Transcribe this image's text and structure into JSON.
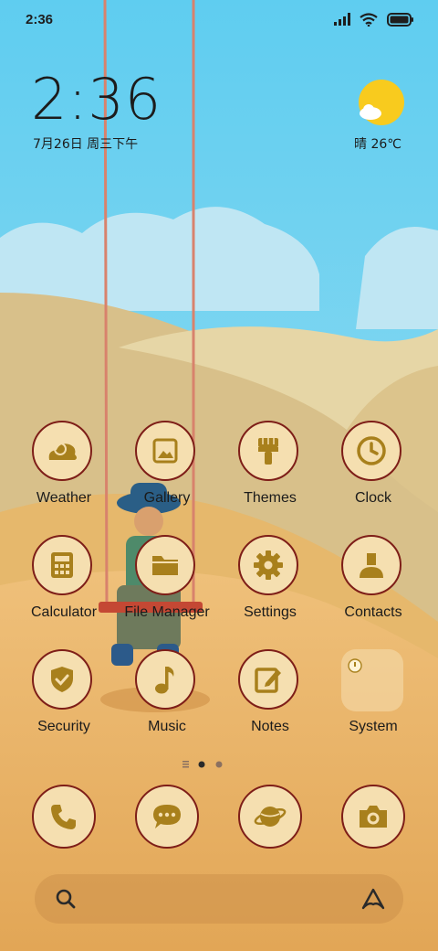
{
  "status_bar": {
    "time": "2:36"
  },
  "widget": {
    "time": "2:36",
    "date": "7月26日 周三下午",
    "weather": "晴 26℃"
  },
  "apps": [
    {
      "label": "Weather",
      "icon": "weather-icon"
    },
    {
      "label": "Gallery",
      "icon": "gallery-icon"
    },
    {
      "label": "Themes",
      "icon": "themes-icon"
    },
    {
      "label": "Clock",
      "icon": "clock-icon"
    },
    {
      "label": "Calculator",
      "icon": "calculator-icon"
    },
    {
      "label": "File Manager",
      "icon": "folder-icon"
    },
    {
      "label": "Settings",
      "icon": "gear-icon"
    },
    {
      "label": "Contacts",
      "icon": "contacts-icon"
    },
    {
      "label": "Security",
      "icon": "shield-icon"
    },
    {
      "label": "Music",
      "icon": "music-note-icon"
    },
    {
      "label": "Notes",
      "icon": "notes-icon"
    },
    {
      "label": "System",
      "icon": "folder-icon"
    }
  ],
  "dock": [
    {
      "icon": "phone-icon"
    },
    {
      "icon": "messages-icon"
    },
    {
      "icon": "browser-icon"
    },
    {
      "icon": "camera-icon"
    }
  ],
  "page_indicator": {
    "pages": 2,
    "current": 1
  },
  "colors": {
    "icon_fill": "#f5dfb0",
    "icon_border": "#7e1e18",
    "glyph": "#a8801c",
    "sky": "#5ecdf0"
  }
}
